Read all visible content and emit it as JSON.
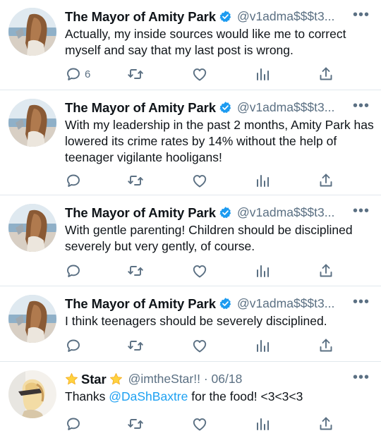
{
  "tweets": [
    {
      "name": "The Mayor of Amity Park",
      "handle": "@v1adma$$$t3...",
      "text": "Actually, my inside sources would like me to correct myself and say that my last post is wrong.",
      "reply_count": "6"
    },
    {
      "name": "The Mayor of Amity Park",
      "handle": "@v1adma$$$t3...",
      "text": "With my leadership in the past 2 months, Amity Park has lowered its crime rates by 14% without the help of teenager vigilante hooligans!",
      "reply_count": ""
    },
    {
      "name": "The Mayor of Amity Park",
      "handle": "@v1adma$$$t3...",
      "text": "With gentle parenting! Children should be disciplined severely but very gently, of course.",
      "reply_count": ""
    },
    {
      "name": "The Mayor of Amity Park",
      "handle": "@v1adma$$$t3...",
      "text": "I think teenagers should be severely disciplined.",
      "reply_count": ""
    },
    {
      "name": "Star",
      "handle": "@imtheStar!! · 06/18",
      "text_before": "Thanks ",
      "mention": "@DaShBaxtre",
      "text_after": " for the food! <3<3<3",
      "reply_count": ""
    }
  ],
  "more_label": "•••",
  "icons": [
    "reply-icon",
    "retweet-icon",
    "like-icon",
    "analytics-icon",
    "share-icon",
    "verified-badge-icon",
    "star-emoji-icon",
    "more-icon"
  ],
  "colors": {
    "accent": "#1da1f2",
    "secondary_text": "#5b7083",
    "divider": "#e1e8ed"
  }
}
